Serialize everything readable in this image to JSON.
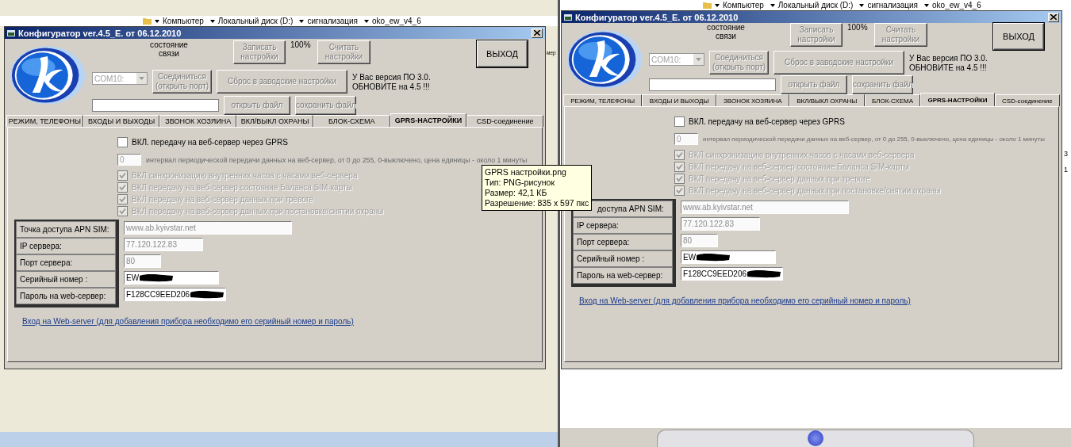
{
  "panes": [
    {
      "kind": "explorer",
      "breadcrumb": [
        "Компьютер",
        "Локальный диск (D:)",
        "сигнализация",
        "oko_ew_v4_6"
      ],
      "edge_texts": [
        "мер"
      ],
      "window": {
        "title": "Конфигуратор  ver.4.5_E. от 06.12.2010",
        "status_label": "состояние\nсвязи",
        "write_button": {
          "label": "Записать\nнастройки",
          "disabled": true
        },
        "progress_text": "100%",
        "read_button": {
          "label": "Считать\nнастройки",
          "disabled": true
        },
        "exit_button": {
          "label": "ВЫХОД",
          "disabled": false
        },
        "port_combo": {
          "value": "COM10:",
          "disabled": true
        },
        "connect_button": {
          "label": "Соединиться\n(открыть порт)",
          "disabled": true
        },
        "reset_button": {
          "label": "Сброс в заводские настройки",
          "disabled": true
        },
        "version_notice": "У Вас версия ПО 3.0.\nОБНОВИТЕ на 4.5 !!!",
        "open_file_button": {
          "label": "открыть файл",
          "disabled": true
        },
        "save_file_button": {
          "label": "сохранить файл",
          "disabled": true
        },
        "tabs": [
          {
            "label": "РЕЖИМ, ТЕЛЕФОНЫ",
            "selected": false
          },
          {
            "label": "ВХОДЫ И ВЫХОДЫ",
            "selected": false
          },
          {
            "label": "ЗВОНОК ХОЗЯИНА",
            "selected": false
          },
          {
            "label": "ВКЛ/ВЫКЛ ОХРАНЫ",
            "selected": false
          },
          {
            "label": "БЛОК-СХЕМА",
            "selected": false
          },
          {
            "label": "GPRS-НАСТРОЙКИ",
            "selected": true
          },
          {
            "label": "CSD-соединение",
            "selected": false
          }
        ],
        "gprs_enable": {
          "label": "ВКЛ. передачу на веб-сервер через GPRS",
          "checked": false,
          "disabled": false
        },
        "interval": {
          "value": "0",
          "label": "интервал периодической передачи данных на веб-сервер, от 0 до 255, 0-выключено, цена единицы - около 1 минуты",
          "disabled": true
        },
        "options": [
          {
            "label": "ВКЛ синхронизацию внутренних часов с часами веб-сервера",
            "checked": true,
            "disabled": true
          },
          {
            "label": "ВКЛ передачу на веб-сервер состояние Баланса SIM-карты",
            "checked": true,
            "disabled": true
          },
          {
            "label": "ВКЛ передачу на веб-сервер данных при тревоге",
            "checked": true,
            "disabled": true
          },
          {
            "label": "ВКЛ передачу на веб-сервер данных при постановке/снятии охраны",
            "checked": true,
            "disabled": true
          }
        ],
        "fields": [
          {
            "label": "Точка доступа APN  SIM:",
            "value": "www.ab.kyivstar.net",
            "disabled": true,
            "redacted": false
          },
          {
            "label": "IP сервера:",
            "value": "77.120.122.83",
            "disabled": true,
            "redacted": false
          },
          {
            "label": "Порт сервера:",
            "value": "80",
            "disabled": true,
            "redacted": false
          },
          {
            "label": "Серийный номер :",
            "value": "EW",
            "disabled": false,
            "redacted": true
          },
          {
            "label": "Пароль на web-сервер:",
            "value": "F128CC9EED206",
            "disabled": false,
            "redacted": true
          }
        ],
        "web_link": "Вход на Web-server (для добавления прибора необходимо его серийный номер и пароль)"
      }
    },
    {
      "kind": "viewer",
      "breadcrumb": [
        "Компьютер",
        "Локальный диск (D:)",
        "сигнализация",
        "oko_ew_v4_6"
      ],
      "edge_texts": [
        "3",
        "1"
      ],
      "window": {
        "title": "Конфигуратор  ver.4.5_E. от 06.12.2010",
        "status_label": "состояние\nсвязи",
        "write_button": {
          "label": "Записать\nнастройки",
          "disabled": true
        },
        "progress_text": "100%",
        "read_button": {
          "label": "Считать\nнастройки",
          "disabled": true
        },
        "exit_button": {
          "label": "ВЫХОД",
          "disabled": false
        },
        "port_combo": {
          "value": "COM10:",
          "disabled": true
        },
        "connect_button": {
          "label": "Соединиться\n(открыть порт)",
          "disabled": true
        },
        "reset_button": {
          "label": "Сброс в заводские настройки",
          "disabled": true
        },
        "version_notice": "У Вас версия ПО 3.0.\nОБНОВИТЕ на 4.5 !!!",
        "open_file_button": {
          "label": "открыть файл",
          "disabled": true
        },
        "save_file_button": {
          "label": "сохранить файл",
          "disabled": true
        },
        "tabs": [
          {
            "label": "РЕЖИМ, ТЕЛЕФОНЫ",
            "selected": false
          },
          {
            "label": "ВХОДЫ И ВЫХОДЫ",
            "selected": false
          },
          {
            "label": "ЗВОНОК ХОЗЯИНА",
            "selected": false
          },
          {
            "label": "ВКЛ/ВЫКЛ ОХРАНЫ",
            "selected": false
          },
          {
            "label": "БЛОК-СХЕМА",
            "selected": false
          },
          {
            "label": "GPRS-НАСТРОЙКИ",
            "selected": true
          },
          {
            "label": "CSD-соединение",
            "selected": false
          }
        ],
        "gprs_enable": {
          "label": "ВКЛ. передачу на веб-сервер через GPRS",
          "checked": false,
          "disabled": false
        },
        "interval": {
          "value": "0",
          "label": "интервал периодической передачи данных на веб-сервер, от 0 до 255, 0-выключено, цена единицы - около 1 минуты",
          "disabled": true
        },
        "options": [
          {
            "label": "ВКЛ синхронизацию внутренних часов с часами веб-сервера",
            "checked": true,
            "disabled": true
          },
          {
            "label": "ВКЛ передачу на веб-сервер состояние Баланса SIM-карты",
            "checked": true,
            "disabled": true
          },
          {
            "label": "ВКЛ передачу на веб-сервер данных при тревоге",
            "checked": true,
            "disabled": true
          },
          {
            "label": "ВКЛ передачу на веб-сервер данных при постановке/снятии охраны",
            "checked": true,
            "disabled": true
          }
        ],
        "fields": [
          {
            "label": "доступа APN  SIM:",
            "value": "www.ab.kyivstar.net",
            "disabled": true,
            "redacted": false
          },
          {
            "label": "IP сервера:",
            "value": "77.120.122.83",
            "disabled": true,
            "redacted": false
          },
          {
            "label": "Порт сервера:",
            "value": "80",
            "disabled": true,
            "redacted": false
          },
          {
            "label": "Серийный номер :",
            "value": "EW",
            "disabled": false,
            "redacted": true
          },
          {
            "label": "Пароль на web-сервер:",
            "value": "F128CC9EED206",
            "disabled": false,
            "redacted": true
          }
        ],
        "web_link": "Вход на Web-server (для добавления прибора необходимо его серийный номер и пароль)"
      }
    }
  ],
  "tooltip": {
    "lines": [
      "GPRS настройки.png",
      "Тип: PNG-рисунок",
      "Размер: 42,1 КБ",
      "Разрешение: 835 x 597 пкс"
    ]
  }
}
